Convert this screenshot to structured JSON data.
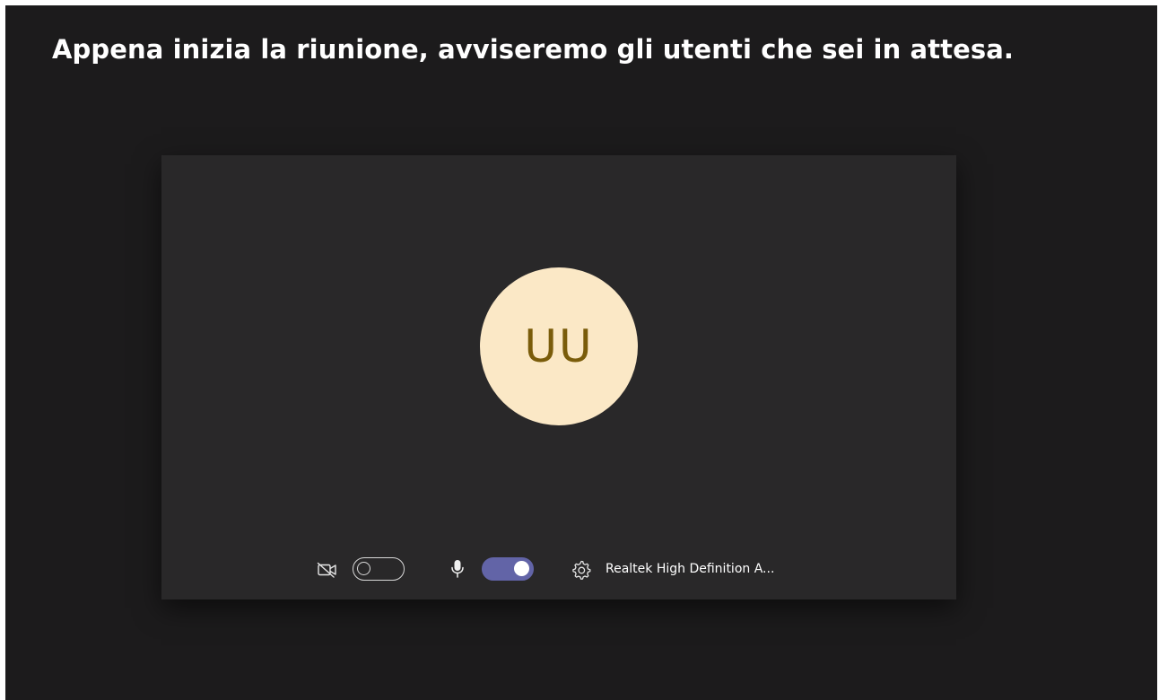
{
  "lobby": {
    "message": "Appena inizia la riunione, avviseremo gli utenti che sei in attesa."
  },
  "preview": {
    "avatar_initials": "UU",
    "avatar_bg": "#fbe8c6",
    "avatar_fg": "#7a5c0a"
  },
  "controls": {
    "camera": {
      "icon": "camera-off-icon",
      "enabled": false
    },
    "microphone": {
      "icon": "microphone-icon",
      "enabled": true
    },
    "device_settings": {
      "icon": "gear-icon",
      "label": "Realtek High Definition A..."
    },
    "accent_color": "#6264a7"
  }
}
